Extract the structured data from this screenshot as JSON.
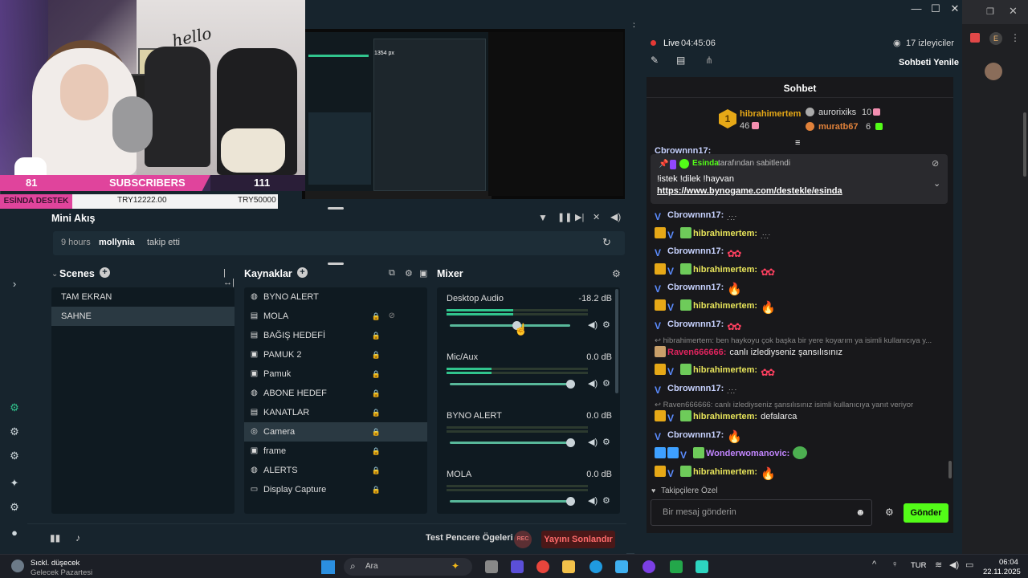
{
  "overlay": {
    "subscriber_count": "81",
    "subscribers_label": "SUBSCRIBERS",
    "subscriber_goal": "111",
    "destek_label": "ESİNDA DESTEK",
    "destek_current": "TRY12222.00",
    "destek_goal": "TRY50000",
    "wall_text": "hello"
  },
  "mini_akis": {
    "title": "Mini Akış",
    "event_time": "9 hours",
    "event_user": "mollynia",
    "event_action": "takip etti"
  },
  "scenes": {
    "title": "Scenes",
    "items": [
      {
        "label": "TAM EKRAN"
      },
      {
        "label": "SAHNE"
      }
    ]
  },
  "sources": {
    "title": "Kaynaklar",
    "items": [
      {
        "label": "BYNO ALERT",
        "icon": "globe-icon"
      },
      {
        "label": "MOLA",
        "icon": "file-icon"
      },
      {
        "label": "BAĞIŞ HEDEFİ",
        "icon": "file-icon"
      },
      {
        "label": "PAMUK 2",
        "icon": "image-icon"
      },
      {
        "label": "Pamuk",
        "icon": "image-icon"
      },
      {
        "label": "ABONE HEDEF",
        "icon": "globe-icon"
      },
      {
        "label": "KANATLAR",
        "icon": "file-icon"
      },
      {
        "label": "Camera",
        "icon": "camera-icon"
      },
      {
        "label": "frame",
        "icon": "image-icon"
      },
      {
        "label": "ALERTS",
        "icon": "globe-icon"
      },
      {
        "label": "Display Capture",
        "icon": "monitor-icon"
      }
    ]
  },
  "mixer": {
    "title": "Mixer",
    "channels": [
      {
        "name": "Desktop Audio",
        "db": "-18.2 dB",
        "level": 0.47,
        "fader": 0.55
      },
      {
        "name": "Mic/Aux",
        "db": "0.0 dB",
        "level": 0.32,
        "fader": 1.0
      },
      {
        "name": "BYNO ALERT",
        "db": "0.0 dB",
        "level": 0.0,
        "fader": 1.0
      },
      {
        "name": "MOLA",
        "db": "0.0 dB",
        "level": 0.0,
        "fader": 1.0
      }
    ]
  },
  "bottom": {
    "test_label": "Test Pencere Ögeleri",
    "rec_label": "REC",
    "end_label": "Yayını Sonlandır"
  },
  "live": {
    "label": "Live",
    "time": "04:45:06",
    "viewers": "17 izleyiciler",
    "refresh": "Sohbeti Yenile"
  },
  "chat": {
    "title": "Sohbet",
    "top_gifter": {
      "name": "hibrahimertem",
      "count": "46"
    },
    "gifter_2": {
      "name": "aurorixiks",
      "count": "10"
    },
    "gifter_3": {
      "name": "muratb67",
      "count": "6"
    },
    "pinned_by_user": "Esinda",
    "pinned_by_text": "tarafından sabitlendi",
    "pinned_text": "!istek !dilek !hayvan",
    "pinned_link": "https://www.bynogame.com/destekle/esinda",
    "partial_top_user": "Cbrownnn17:",
    "messages": [
      {
        "user": "Cbrownnn17:",
        "color": "#c7d2fe",
        "badges": "v",
        "text": "",
        "emote": "dots"
      },
      {
        "user": "hibrahimertem:",
        "color": "#e6e35a",
        "badges": "cvg",
        "text": "",
        "emote": "dots"
      },
      {
        "user": "Cbrownnn17:",
        "color": "#c7d2fe",
        "badges": "v",
        "text": "",
        "emote": "red"
      },
      {
        "user": "hibrahimertem:",
        "color": "#e6e35a",
        "badges": "cvg",
        "text": "",
        "emote": "red"
      },
      {
        "user": "Cbrownnn17:",
        "color": "#c7d2fe",
        "badges": "v",
        "text": "",
        "emote": "fire"
      },
      {
        "user": "hibrahimertem:",
        "color": "#e6e35a",
        "badges": "cvg",
        "text": "",
        "emote": "fire"
      },
      {
        "user": "Cbrownnn17:",
        "color": "#c7d2fe",
        "badges": "v",
        "text": "",
        "emote": "red"
      }
    ],
    "reply_1": "hibrahimertem: ben haykoyu çok başka bir yere koyarım ya isimli kullanıcıya y...",
    "raven_user": "Raven666666:",
    "raven_text": "canlı izlediyseniz şansılısınız",
    "messages_2": [
      {
        "user": "hibrahimertem:",
        "color": "#e6e35a",
        "badges": "cvg",
        "text": "",
        "emote": "red"
      },
      {
        "user": "Cbrownnn17:",
        "color": "#c7d2fe",
        "badges": "v",
        "text": "",
        "emote": "dots"
      }
    ],
    "reply_2": "Raven666666: canlı izlediyseniz şansılısınız isimli kullanıcıya yanıt veriyor",
    "messages_3": [
      {
        "user": "hibrahimertem:",
        "color": "#e6e35a",
        "badges": "cvg",
        "text": "defalarca",
        "emote": ""
      },
      {
        "user": "Cbrownnn17:",
        "color": "#c7d2fe",
        "badges": "v",
        "text": "",
        "emote": "fire"
      },
      {
        "user": "Wonderwomanovic:",
        "color": "#c084fc",
        "badges": "bbvg",
        "text": "",
        "emote": "frog"
      },
      {
        "user": "hibrahimertem:",
        "color": "#e6e35a",
        "badges": "cvg",
        "text": "",
        "emote": "fire"
      }
    ],
    "followers_only": "Takipçilere Özel",
    "input_placeholder": "Bir mesaj gönderin",
    "send_label": "Gönder"
  },
  "taskbar": {
    "weather_title": "Sıckl. düşecek",
    "weather_sub": "Gelecek Pazartesi",
    "search_label": "Ara",
    "lang": "TUR",
    "time": "06:04",
    "date": "22.11.2025"
  },
  "preview": {
    "coord_text": "1354 px"
  },
  "colors": {
    "accent_green": "#31c48d",
    "send_green": "#53fc18",
    "pink": "#e0449c",
    "live_red": "#e53935"
  }
}
